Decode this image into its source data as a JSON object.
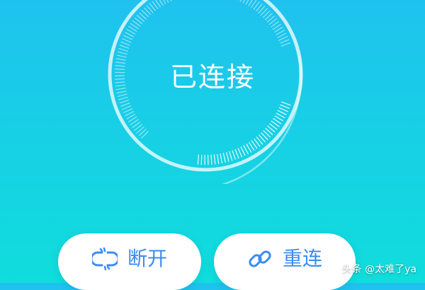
{
  "status": {
    "text": "已连接",
    "icon": "connection-dial-ring"
  },
  "actions": {
    "disconnect": {
      "label": "断开",
      "icon": "broken-link-icon"
    },
    "reconnect": {
      "label": "重连",
      "icon": "link-icon"
    }
  },
  "watermark": {
    "text": "头条 @太难了ya"
  },
  "colors": {
    "background_top": "#1FC2EE",
    "background_bottom": "#10DDDC",
    "ring": "#FFFFFF",
    "button_background": "#FFFFFF",
    "button_accent": "#3B8BF2"
  }
}
